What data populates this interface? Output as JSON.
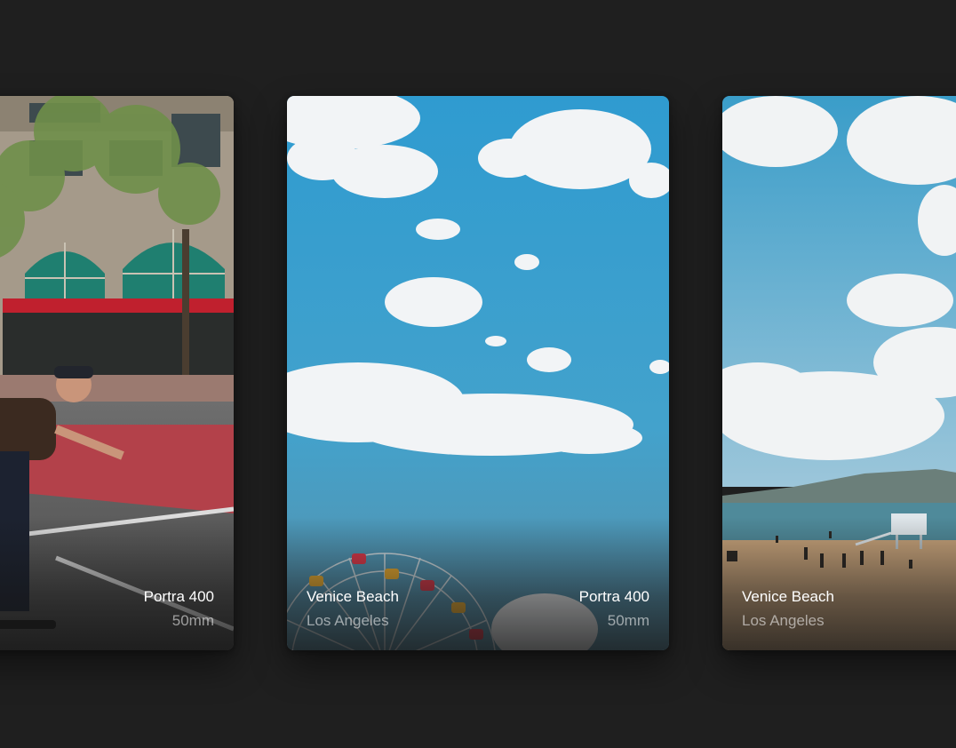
{
  "cards": [
    {
      "id": "left",
      "film": "Portra 400",
      "lens": "50mm",
      "place": "",
      "city": ""
    },
    {
      "id": "center",
      "film": "Portra 400",
      "lens": "50mm",
      "place": "Venice Beach",
      "city": "Los Angeles"
    },
    {
      "id": "right",
      "film": "",
      "lens": "",
      "place": "Venice Beach",
      "city": "Los Angeles"
    }
  ],
  "colors": {
    "background": "#1f1f1f",
    "sky": "#3a9dc9",
    "cloud": "#f2f4f6",
    "sand": "#c9a47b",
    "road_red": "#b3414a",
    "awning": "#c0202e"
  }
}
